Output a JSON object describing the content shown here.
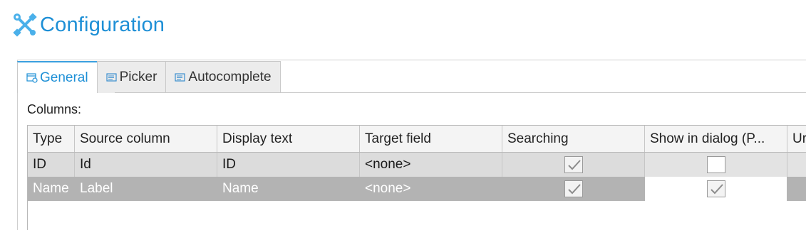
{
  "header": {
    "title": "Configuration",
    "icon": "tools-icon",
    "accent": "#1d8fd6"
  },
  "tabs": [
    {
      "label": "General",
      "icon": "general-tab-icon",
      "active": true
    },
    {
      "label": "Picker",
      "icon": "picker-tab-icon",
      "active": false
    },
    {
      "label": "Autocomplete",
      "icon": "autocomplete-tab-icon",
      "active": false
    }
  ],
  "columns_label": "Columns:",
  "grid": {
    "headers": [
      "Type",
      "Source column",
      "Display text",
      "Target field",
      "Searching",
      "Show in dialog (P...",
      "Ur"
    ],
    "rows": [
      {
        "type": "ID",
        "source": "Id",
        "display": "ID",
        "target": "<none>",
        "searching": true,
        "show_in_dialog": false,
        "selected": false
      },
      {
        "type": "Name",
        "source": "Label",
        "display": "Name",
        "target": "<none>",
        "searching": true,
        "show_in_dialog": true,
        "selected": true
      }
    ]
  }
}
